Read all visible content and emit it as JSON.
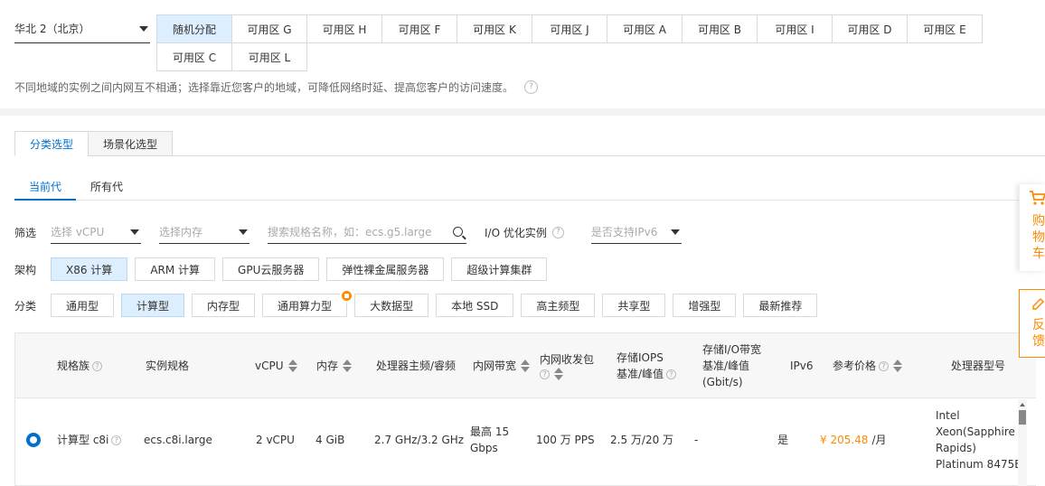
{
  "region": {
    "label": "华北 2（北京）"
  },
  "zones": {
    "row1": [
      "随机分配",
      "可用区 G",
      "可用区 H",
      "可用区 F",
      "可用区 K",
      "可用区 J",
      "可用区 A",
      "可用区 B",
      "可用区 I",
      "可用区 D",
      "可用区 E"
    ],
    "row2": [
      "可用区 C",
      "可用区 L"
    ],
    "selected": "随机分配"
  },
  "hint": "不同地域的实例之间内网互不相通；选择靠近您客户的地域，可降低网络时延、提高您客户的访问速度。",
  "type_tabs": [
    "分类选型",
    "场景化选型"
  ],
  "gen_tabs": [
    "当前代",
    "所有代"
  ],
  "filter": {
    "label": "筛选",
    "vcpu_placeholder": "选择 vCPU",
    "mem_placeholder": "选择内存",
    "search_placeholder": "搜索规格名称，如：ecs.g5.large",
    "io_label": "I/O 优化实例",
    "ipv6_placeholder": "是否支持IPv6"
  },
  "arch": {
    "label": "架构",
    "items": [
      "X86 计算",
      "ARM 计算",
      "GPU云服务器",
      "弹性裸金属服务器",
      "超级计算集群"
    ],
    "selected": "X86 计算"
  },
  "category": {
    "label": "分类",
    "items": [
      "通用型",
      "计算型",
      "内存型",
      "通用算力型",
      "大数据型",
      "本地 SSD",
      "高主频型",
      "共享型",
      "增强型",
      "最新推荐"
    ],
    "selected": "计算型"
  },
  "table": {
    "headers": {
      "family": "规格族",
      "spec": "实例规格",
      "vcpu": "vCPU",
      "mem": "内存",
      "freq": "处理器主频/睿频",
      "bw": "内网带宽",
      "pps": "内网收发包",
      "iops_1": "存储IOPS",
      "iops_2": "基准/峰值",
      "io_bw_1": "存储I/O带宽",
      "io_bw_2": "基准/峰值",
      "io_bw_3": "(Gbit/s)",
      "ipv6": "IPv6",
      "price": "参考价格",
      "cpu_model": "处理器型号"
    },
    "rows": [
      {
        "family": "计算型 c8i",
        "spec": "ecs.c8i.large",
        "vcpu": "2 vCPU",
        "mem": "4 GiB",
        "freq": "2.7 GHz/3.2 GHz",
        "bw_1": "最高 15",
        "bw_2": "Gbps",
        "pps": "100 万 PPS",
        "iops": "2.5 万/20 万",
        "io_bw": "-",
        "ipv6": "是",
        "price_amount": "¥ 205.48",
        "price_unit": "/月",
        "cpu_model_1": "Intel",
        "cpu_model_2": "Xeon(Sapphire",
        "cpu_model_3": "Rapids)",
        "cpu_model_4": "Platinum 8475B"
      }
    ]
  },
  "side": {
    "cart": "购物车",
    "feedback": "反馈"
  },
  "colors": {
    "accent": "#0070cc",
    "price": "#ff8a00",
    "selected_bg": "#ddeffe"
  }
}
